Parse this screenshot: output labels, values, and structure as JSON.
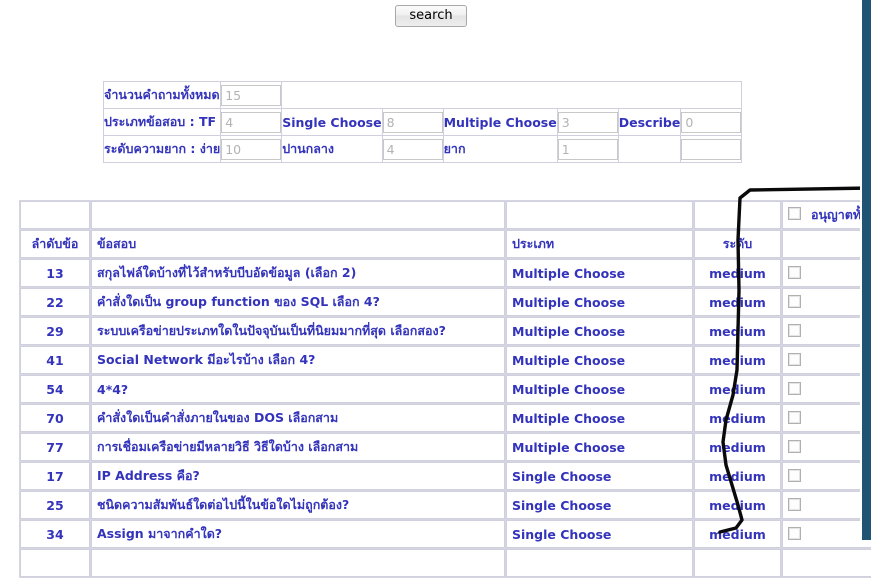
{
  "toolbar": {
    "search_label": "search"
  },
  "summary": {
    "rows": [
      {
        "cells": [
          {
            "kind": "label",
            "text": "จำนวนคำถามทั้งหมด"
          },
          {
            "kind": "input",
            "value": "15"
          },
          {
            "kind": "blank",
            "text": ""
          }
        ]
      },
      {
        "cells": [
          {
            "kind": "label",
            "text": "ประเภทข้อสอบ : TF"
          },
          {
            "kind": "input",
            "value": "4"
          },
          {
            "kind": "label",
            "text": "Single Choose"
          },
          {
            "kind": "input",
            "value": "8"
          },
          {
            "kind": "label",
            "text": "Multiple Choose"
          },
          {
            "kind": "input",
            "value": "3"
          },
          {
            "kind": "label",
            "text": "Describe"
          },
          {
            "kind": "input",
            "value": "0"
          }
        ]
      },
      {
        "cells": [
          {
            "kind": "label",
            "text": "ระดับความยาก : ง่าย"
          },
          {
            "kind": "input",
            "value": "10"
          },
          {
            "kind": "label",
            "text": "ปานกลาง"
          },
          {
            "kind": "input",
            "value": "4"
          },
          {
            "kind": "label",
            "text": "ยาก"
          },
          {
            "kind": "input",
            "value": "1"
          },
          {
            "kind": "label",
            "text": ""
          },
          {
            "kind": "empty",
            "value": ""
          }
        ]
      }
    ],
    "labels": {
      "total_questions": "จำนวนคำถามทั้งหมด",
      "total_questions_value": "15",
      "type_tf": "ประเภทข้อสอบ : TF",
      "type_tf_value": "4",
      "single_choose": "Single Choose",
      "single_choose_value": "8",
      "multiple_choose": "Multiple Choose",
      "multiple_choose_value": "3",
      "describe": "Describe",
      "describe_value": "0",
      "level_easy": "ระดับความยาก : ง่าย",
      "level_easy_value": "10",
      "level_medium": "ปานกลาง",
      "level_medium_value": "4",
      "level_hard": "ยาก",
      "level_hard_value": "1"
    }
  },
  "results": {
    "allow_all_label": "อนุญาตทั้งหมด",
    "columns": {
      "no": "ลำดับข้อ",
      "question": "ข้อสอบ",
      "type": "ประเภท",
      "level": "ระดับ",
      "allow": ""
    },
    "rows": [
      {
        "no": "13",
        "question": "สกุลไฟล์ใดบ้างที่ไว้สำหรับบีบอัดข้อมูล (เลือก 2)",
        "type": "Multiple Choose",
        "level": "medium"
      },
      {
        "no": "22",
        "question": "คำสั่งใดเป็น group function ของ  SQL เลือก 4?",
        "type": "Multiple Choose",
        "level": "medium"
      },
      {
        "no": "29",
        "question": "ระบบเครือข่ายประเภทใดในปัจจุบันเป็นที่นิยมมากที่สุด เลือกสอง?",
        "type": "Multiple Choose",
        "level": "medium"
      },
      {
        "no": "41",
        "question": "Social Network มีอะไรบ้าง เลือก 4?",
        "type": "Multiple Choose",
        "level": "medium"
      },
      {
        "no": "54",
        "question": "4*4?",
        "type": "Multiple Choose",
        "level": "medium"
      },
      {
        "no": "70",
        "question": "คำสั่งใดเป็นคำสั่งภายในของ DOS เลือกสาม",
        "type": "Multiple Choose",
        "level": "medium"
      },
      {
        "no": "77",
        "question": "การเชื่อมเครือข่ายมีหลายวิธี วิธีใดบ้าง เลือกสาม",
        "type": "Multiple Choose",
        "level": "medium"
      },
      {
        "no": "17",
        "question": "IP Address คือ?",
        "type": "Single Choose",
        "level": "medium"
      },
      {
        "no": "25",
        "question": "ชนิดความสัมพันธ์ใดต่อไปนี้ในข้อใดไม่ถูกต้อง?",
        "type": "Single Choose",
        "level": "medium"
      },
      {
        "no": "34",
        "question": "Assign มาจากคำใด?",
        "type": "Single Choose",
        "level": "medium"
      }
    ]
  },
  "colors": {
    "text_blue": "#3333bb",
    "edge_teal": "#1f5472",
    "annotation_black": "#000000",
    "table_border": "#d0d0de"
  }
}
